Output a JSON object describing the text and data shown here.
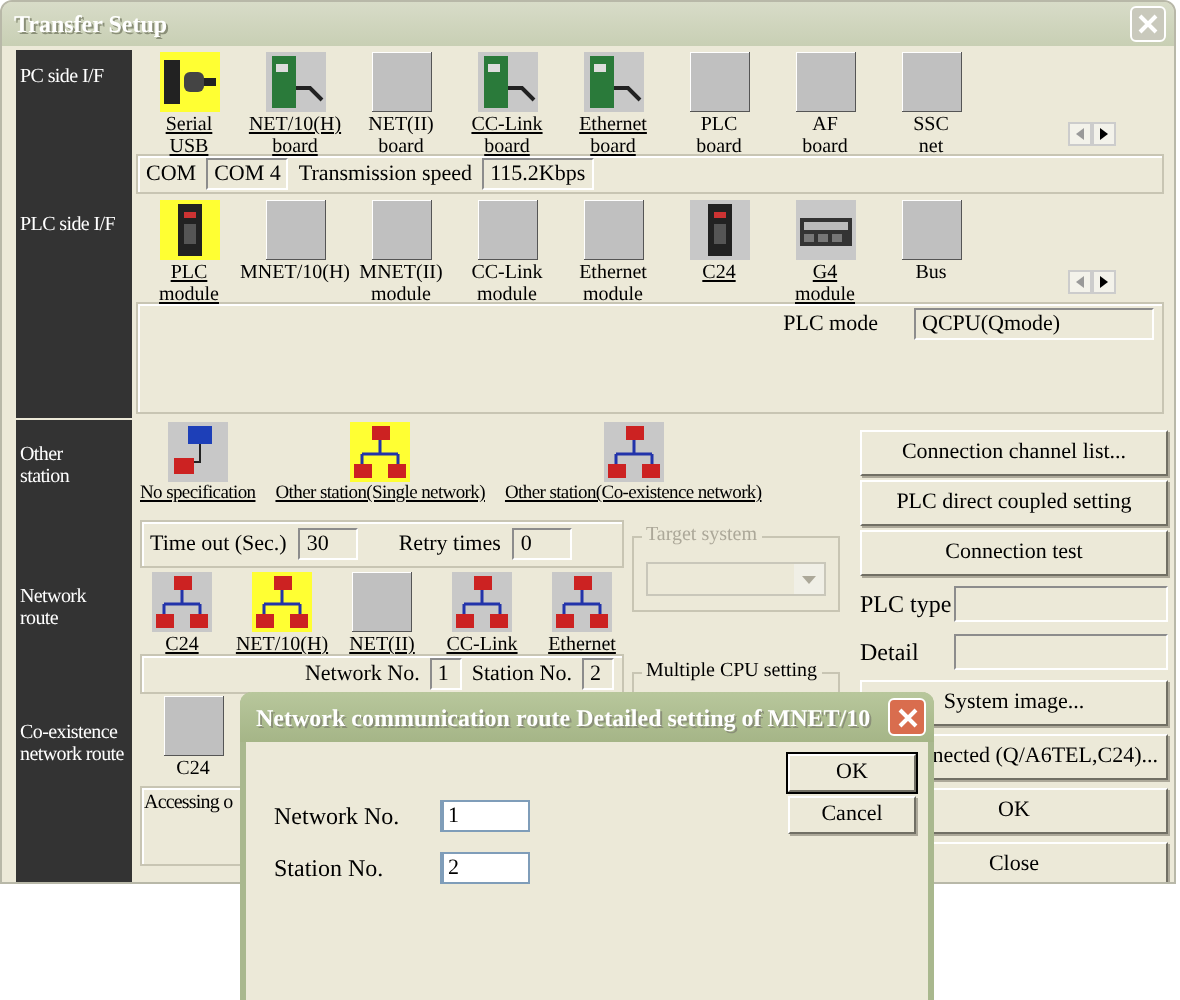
{
  "window": {
    "title": "Transfer Setup"
  },
  "pc_side": {
    "label": "PC side I/F",
    "icons": [
      {
        "label": "Serial\nUSB",
        "kind": "serial",
        "selected": true,
        "available": true
      },
      {
        "label": "NET/10(H)\nboard",
        "kind": "board",
        "selected": false,
        "available": true
      },
      {
        "label": "NET(II)\nboard",
        "kind": "blank",
        "selected": false,
        "available": false
      },
      {
        "label": "CC-Link\nboard",
        "kind": "board",
        "selected": false,
        "available": true
      },
      {
        "label": "Ethernet\nboard",
        "kind": "board",
        "selected": false,
        "available": true
      },
      {
        "label": "PLC\nboard",
        "kind": "blank",
        "selected": false,
        "available": false
      },
      {
        "label": "AF\nboard",
        "kind": "blank",
        "selected": false,
        "available": false
      },
      {
        "label": "SSC\nnet",
        "kind": "blank",
        "selected": false,
        "available": false
      }
    ],
    "com_label": "COM",
    "com_value": "COM 4",
    "speed_label": "Transmission speed",
    "speed_value": "115.2Kbps"
  },
  "plc_side": {
    "label": "PLC side I/F",
    "icons": [
      {
        "label": "PLC\nmodule",
        "kind": "module",
        "selected": true,
        "available": true
      },
      {
        "label": "MNET/10(H)",
        "kind": "blank",
        "selected": false,
        "available": false
      },
      {
        "label": "MNET(II)\nmodule",
        "kind": "blank",
        "selected": false,
        "available": false
      },
      {
        "label": "CC-Link\nmodule",
        "kind": "blank",
        "selected": false,
        "available": false
      },
      {
        "label": "Ethernet\nmodule",
        "kind": "blank",
        "selected": false,
        "available": false
      },
      {
        "label": "C24",
        "kind": "module",
        "selected": false,
        "available": true
      },
      {
        "label": "G4\nmodule",
        "kind": "unit",
        "selected": false,
        "available": true
      },
      {
        "label": "Bus",
        "kind": "blank",
        "selected": false,
        "available": false
      }
    ],
    "mode_label": "PLC mode",
    "mode_value": "QCPU(Qmode)"
  },
  "other_station": {
    "label": "Other\nstation",
    "icons": [
      {
        "label": "No specification",
        "kind": "pc",
        "selected": false,
        "available": true
      },
      {
        "label": "Other station(Single network)",
        "kind": "network",
        "selected": true,
        "available": true
      },
      {
        "label": "Other station(Co-existence network)",
        "kind": "network",
        "selected": false,
        "available": true
      }
    ],
    "timeout_label": "Time out (Sec.)",
    "timeout_value": "30",
    "retry_label": "Retry times",
    "retry_value": "0"
  },
  "network_route": {
    "label": "Network\nroute",
    "icons": [
      {
        "label": "C24",
        "kind": "network",
        "selected": false,
        "available": true
      },
      {
        "label": "NET/10(H)",
        "kind": "network",
        "selected": true,
        "available": true
      },
      {
        "label": "NET(II)",
        "kind": "blank",
        "selected": false,
        "available": true
      },
      {
        "label": "CC-Link",
        "kind": "network",
        "selected": false,
        "available": true
      },
      {
        "label": "Ethernet",
        "kind": "network",
        "selected": false,
        "available": true
      }
    ],
    "network_no_label": "Network No.",
    "network_no_value": "1",
    "station_no_label": "Station No.",
    "station_no_value": "2"
  },
  "coexistence_route": {
    "label": "Co-existence\nnetwork route",
    "icons": [
      {
        "label": "C24",
        "kind": "blank",
        "selected": false,
        "available": false
      }
    ],
    "accessing_text": "Accessing o"
  },
  "target_system": {
    "title": "Target system",
    "disabled": true
  },
  "multiple_cpu": {
    "title": "Multiple CPU setting"
  },
  "right_buttons_top": [
    "Connection  channel  list...",
    "PLC direct coupled setting",
    "Connection test"
  ],
  "plc_type_label": "PLC type",
  "detail_label": "Detail",
  "right_buttons_bottom": [
    "System   image...",
    "nected (Q/A6TEL,C24)...",
    "OK",
    "Close"
  ],
  "dialog": {
    "title": "Network communication route  Detailed setting of MNET/10",
    "network_no_label": "Network No.",
    "network_no_value": "1",
    "station_no_label": "Station No.",
    "station_no_value": "2",
    "buttons": [
      {
        "label": "OK",
        "default": true
      },
      {
        "label": "Cancel",
        "default": false
      }
    ]
  }
}
